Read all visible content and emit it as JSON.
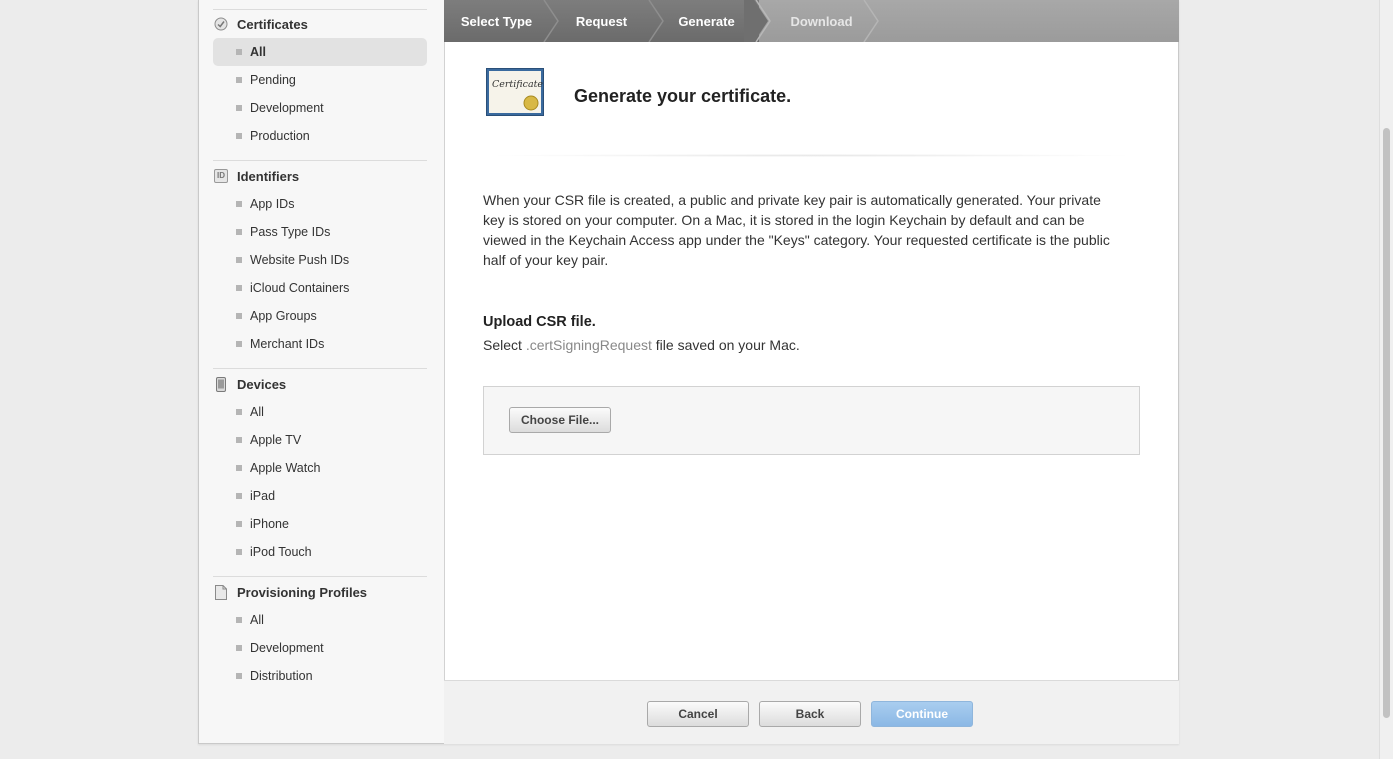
{
  "sidebar": {
    "certificates": {
      "title": "Certificates",
      "icon": "certificate-gear-icon",
      "items": [
        "All",
        "Pending",
        "Development",
        "Production"
      ]
    },
    "identifiers": {
      "title": "Identifiers",
      "icon": "id-badge-icon",
      "badge": "ID",
      "items": [
        "App IDs",
        "Pass Type IDs",
        "Website Push IDs",
        "iCloud Containers",
        "App Groups",
        "Merchant IDs"
      ]
    },
    "devices": {
      "title": "Devices",
      "icon": "device-phone-icon",
      "items": [
        "All",
        "Apple TV",
        "Apple Watch",
        "iPad",
        "iPhone",
        "iPod Touch"
      ]
    },
    "profiles": {
      "title": "Provisioning Profiles",
      "icon": "document-icon",
      "items": [
        "All",
        "Development",
        "Distribution"
      ]
    },
    "selected": "certificates.All"
  },
  "steps": [
    "Select Type",
    "Request",
    "Generate",
    "Download"
  ],
  "current_step": "Generate",
  "content": {
    "title": "Generate your certificate.",
    "certificate_icon_text": "Certificate",
    "description": "When your CSR file is created, a public and private key pair is automatically generated. Your private key is stored on your computer. On a Mac, it is stored in the login Keychain by default and can be viewed in the Keychain Access app under the \"Keys\" category. Your requested certificate is the public half of your key pair.",
    "upload_title": "Upload CSR file.",
    "upload_sub_prefix": "Select ",
    "upload_sub_ext": ".certSigningRequest",
    "upload_sub_suffix": " file saved on your Mac.",
    "choose_file": "Choose File..."
  },
  "footer": {
    "cancel": "Cancel",
    "back": "Back",
    "continue": "Continue"
  },
  "colors": {
    "accent_button": "#8bb8e5",
    "step_done": "#6b6b6b",
    "step_todo": "#9b9b9b"
  }
}
